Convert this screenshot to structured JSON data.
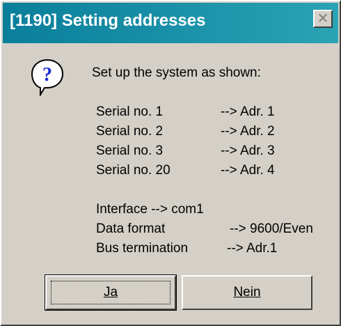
{
  "window": {
    "title": "[1190] Setting addresses",
    "close_icon": "close-icon"
  },
  "icon": "question-icon",
  "prompt": "Set up the system as shown:",
  "serial_rows": [
    {
      "label": "Serial no. 1",
      "value": "--> Adr. 1"
    },
    {
      "label": "Serial no. 2",
      "value": "--> Adr. 2"
    },
    {
      "label": "Serial no. 3",
      "value": "--> Adr. 3"
    },
    {
      "label": "Serial no. 20",
      "value": "--> Adr. 4"
    }
  ],
  "interface_line": "Interface --> com1",
  "settings_rows": [
    {
      "label": "Data format",
      "value": "--> 9600/Even"
    },
    {
      "label": "Bus termination",
      "value": "--> Adr.1"
    }
  ],
  "buttons": {
    "yes_label": "Ja",
    "no_label": "Nein"
  },
  "colors": {
    "titlebar_start": "#0a7e9b",
    "titlebar_end": "#2aa3b4",
    "dialog_bg": "#d4d0c8"
  }
}
